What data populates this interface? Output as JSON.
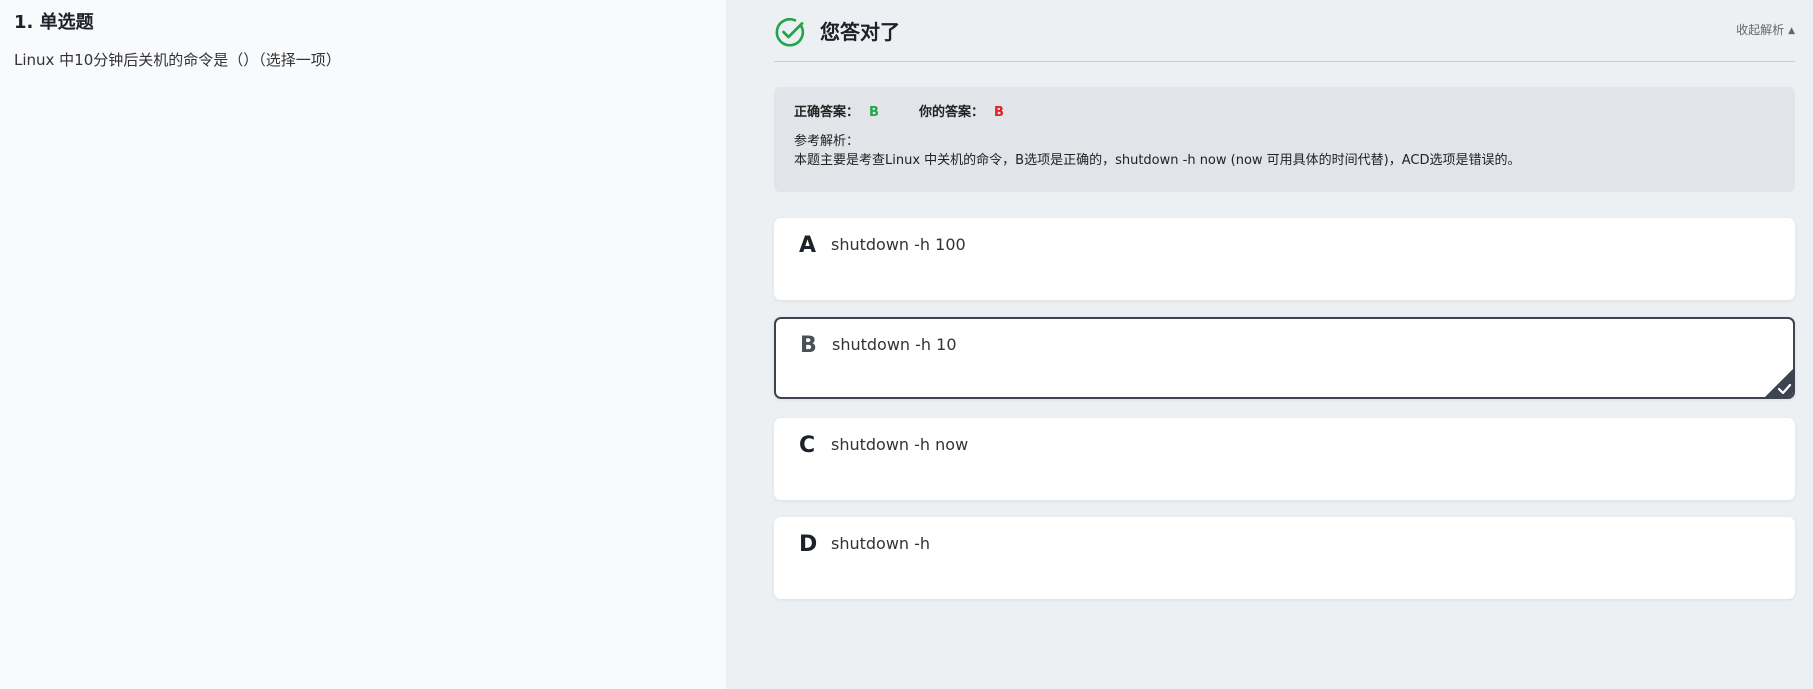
{
  "question": {
    "title": "1. 单选题",
    "stem": "Linux 中10分钟后关机的命令是（）（选择一项）"
  },
  "result": {
    "title": "您答对了",
    "collapse_label": "收起解析",
    "collapse_icon": "caret-up-icon",
    "status_color": "#22a447"
  },
  "analysis": {
    "correct_label": "正确答案：",
    "correct_value": "B",
    "yours_label": "你的答案：",
    "yours_value": "B",
    "ref_label": "参考解析：",
    "ref_text": "本题主要是考查Linux 中关机的命令，B选项是正确的，shutdown -h now (now 可用具体的时间代替)，ACD选项是错误的。"
  },
  "options": [
    {
      "letter": "A",
      "text": "shutdown -h 100"
    },
    {
      "letter": "B",
      "text": "shutdown -h 10",
      "selected": true
    },
    {
      "letter": "C",
      "text": "shutdown -h now"
    },
    {
      "letter": "D",
      "text": "shutdown -h"
    }
  ]
}
